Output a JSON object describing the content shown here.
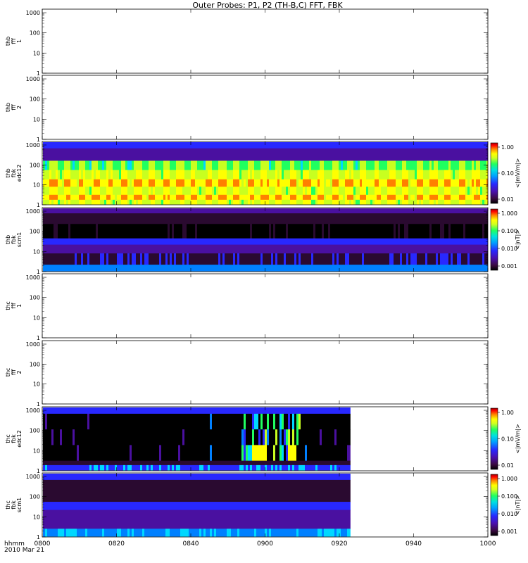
{
  "title": "Outer Probes: P1, P2 (TH-B,C) FFT, FBK",
  "time_axis": {
    "tick_labels": [
      "0800",
      "0820",
      "0840",
      "0900",
      "0920",
      "0940",
      "1000"
    ],
    "label_line1": "hhmm",
    "label_line2": "2010 Mar 21"
  },
  "y_ticks": [
    "1",
    "10",
    "100",
    "1000"
  ],
  "panels": [
    {
      "label": [
        "thb",
        "fff",
        "1"
      ],
      "type": "empty"
    },
    {
      "label": [
        "thb",
        "fff",
        "2"
      ],
      "type": "empty"
    },
    {
      "label": [
        "thb",
        "fbk",
        "edc12"
      ],
      "type": "spectrogram",
      "pattern": "b_edc",
      "colorbar": {
        "label": "<|mV/m|>",
        "ticks": [
          "1.00",
          "0.10",
          "0.01"
        ]
      }
    },
    {
      "label": [
        "thb",
        "fbk",
        "scm1"
      ],
      "type": "spectrogram",
      "pattern": "b_scm",
      "colorbar": {
        "label": "<|nT|>",
        "ticks": [
          "1.000",
          "0.100",
          "0.010",
          "0.001"
        ]
      }
    },
    {
      "label": [
        "thc",
        "fff",
        "1"
      ],
      "type": "empty"
    },
    {
      "label": [
        "thc",
        "fff",
        "2"
      ],
      "type": "empty"
    },
    {
      "label": [
        "thc",
        "fbk",
        "edc12"
      ],
      "type": "spectrogram",
      "pattern": "c_edc",
      "colorbar": {
        "label": "<|mV/m|>",
        "ticks": [
          "1.00",
          "0.10",
          "0.01"
        ]
      }
    },
    {
      "label": [
        "thc",
        "fbk",
        "scm1"
      ],
      "type": "spectrogram",
      "pattern": "c_scm",
      "colorbar": {
        "label": "<|nT|>",
        "ticks": [
          "1.000",
          "0.100",
          "0.010",
          "0.001"
        ]
      }
    }
  ],
  "colors": {
    "scale": [
      "#000000",
      "#2a0a30",
      "#4a10a0",
      "#2828ff",
      "#0080ff",
      "#00d8ff",
      "#20ff60",
      "#c8ff20",
      "#ffff00",
      "#ff8000",
      "#ff0000",
      "#b00000"
    ]
  },
  "chart_data": {
    "type": "heatmap",
    "title": "Outer Probes: P1, P2 (TH-B,C) FFT, FBK",
    "x_range": [
      "0800",
      "1000"
    ],
    "y_range": [
      1,
      1500
    ],
    "y_scale": "log",
    "series": [
      {
        "name": "thb fbk edc12",
        "units": "<|mV/m|>",
        "color_range": [
          0.005,
          1.5
        ],
        "time_coverage": [
          "0800",
          "1000"
        ]
      },
      {
        "name": "thb fbk scm1",
        "units": "<|nT|>",
        "color_range": [
          0.0008,
          1.5
        ],
        "time_coverage": [
          "0800",
          "1000"
        ]
      },
      {
        "name": "thc fbk edc12",
        "units": "<|mV/m|>",
        "color_range": [
          0.005,
          1.5
        ],
        "time_coverage": [
          "0800",
          "0923"
        ]
      },
      {
        "name": "thc fbk scm1",
        "units": "<|nT|>",
        "color_range": [
          0.0008,
          1.5
        ],
        "time_coverage": [
          "0800",
          "0923"
        ]
      }
    ]
  }
}
